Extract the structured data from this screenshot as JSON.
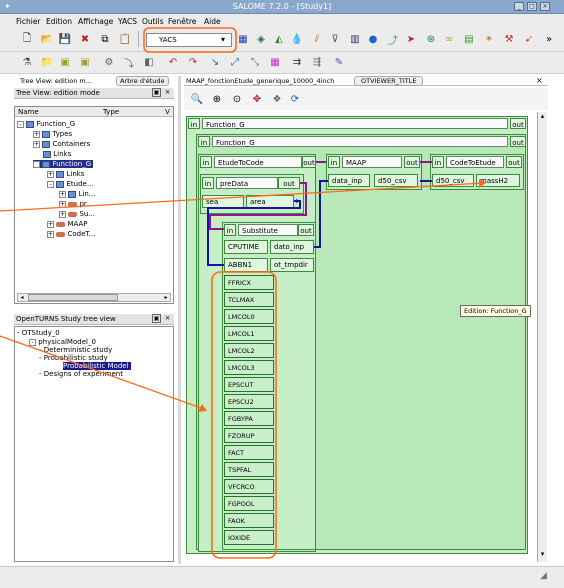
{
  "window": {
    "title": "SALOME 7.2.0 - [Study1]"
  },
  "menu": [
    "Fichier",
    "Edition",
    "Affichage",
    "YACS",
    "Outils",
    "Fenêtre",
    "Aide"
  ],
  "toolbar": {
    "module_selector": "YACS"
  },
  "object_browser": {
    "tabs": [
      "Tree View: edition m...",
      "Arbre d'étude"
    ],
    "header": "Tree View: edition mode",
    "columns": [
      "Name",
      "Type",
      "V"
    ],
    "nodes": [
      "Function_G",
      "Types",
      "Containers",
      "Links",
      "Function_G",
      "Links",
      "Etude...",
      "Lin...",
      "pr...",
      "Su...",
      "MAAP",
      "CodeT..."
    ]
  },
  "openturns": {
    "header": "OpenTURNS Study tree view",
    "nodes": [
      "OTStudy_0",
      "physicalModel_0",
      "Deterministic study",
      "Probabilistic study",
      "Probabilistic Model",
      "Designs of experiment"
    ]
  },
  "viewer": {
    "tabs": [
      "MAAP_fonctionEtude_generique_10000_4inch",
      "OTVIEWER_TITLE"
    ],
    "tooltip": "Edition: Function_G",
    "graph": {
      "in_label": "in",
      "out_label": "out",
      "outer": "Function_G",
      "inner": "Function_G",
      "etude": "EtudeToCode",
      "maap": "MAAP",
      "codeetude": "CodeToEtude",
      "pre": "preData",
      "pre_ports": [
        "sea",
        "area"
      ],
      "maap_ports": [
        "data_inp",
        "d50_csv"
      ],
      "code_ports": [
        "d50_csv",
        "massH2"
      ],
      "subst": "Substitute",
      "subst_ports": [
        [
          "CPUTIME",
          "dato_inp"
        ],
        [
          "ABBN1",
          "ot_tmpdir"
        ]
      ],
      "params": [
        "FFRICX",
        "TCLMAX",
        "LMCOL0",
        "LMCOL1",
        "LMCOL2",
        "LMCOL3",
        "EPSCUT",
        "EPSCU2",
        "FGBYPA",
        "FZORUP",
        "FACT",
        "TSPFAL",
        "VFCRCO",
        "FGPOOL",
        "FAOK",
        "IOXIDE"
      ]
    }
  },
  "colors": {
    "annotation": "#ff6a1a",
    "node_fill": "#c6eec6",
    "link_blue": "#1414a0",
    "link_purple": "#8a1a8a"
  }
}
